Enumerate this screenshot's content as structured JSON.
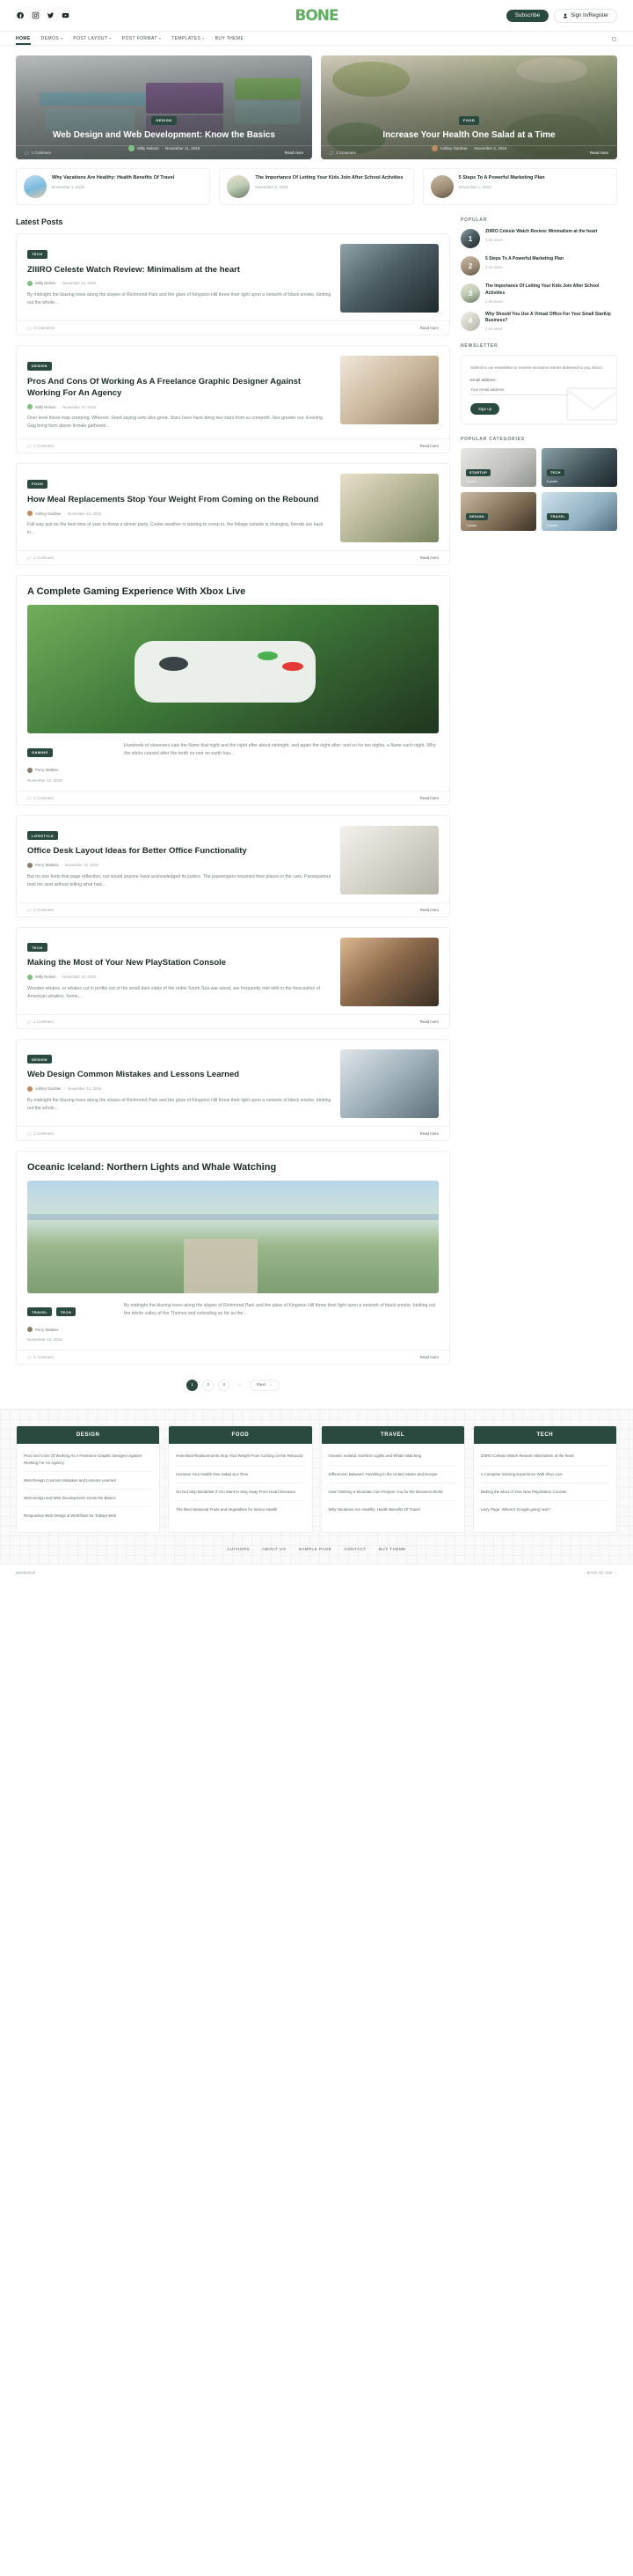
{
  "topbar": {
    "social": [
      "facebook-icon",
      "instagram-icon",
      "twitter-icon",
      "youtube-icon"
    ],
    "logo": "BONE",
    "subscribe_label": "Subscribe",
    "signin_label": "Sign In/Register"
  },
  "nav": {
    "items": [
      {
        "label": "HOME",
        "has_caret": false,
        "active": true
      },
      {
        "label": "DEMOS",
        "has_caret": true,
        "active": false
      },
      {
        "label": "POST LAYOUT",
        "has_caret": true,
        "active": false
      },
      {
        "label": "POST FORMAT",
        "has_caret": true,
        "active": false
      },
      {
        "label": "TEMPLATES",
        "has_caret": true,
        "active": false
      },
      {
        "label": "BUY THEME",
        "has_caret": false,
        "active": false
      }
    ],
    "search_icon": "search-icon"
  },
  "hero": [
    {
      "category": "DESIGN",
      "title": "Web Design and Web Development: Know the Basics",
      "author": "Willy Nelson",
      "date": "November 11, 2019",
      "comments": "1 Comment",
      "read_more": "Read more"
    },
    {
      "category": "FOOD",
      "title": "Increase Your Health One Salad at a Time",
      "author": "Ashley Gardner",
      "date": "November 2, 2019",
      "comments": "1 Comment",
      "read_more": "Read more"
    }
  ],
  "minis": [
    {
      "title": "Why Vacations Are Healthy: Health Benefits Of Travel",
      "date": "November 1, 2019"
    },
    {
      "title": "The Importance Of Letting Your Kids Join After School Activities",
      "date": "November 8, 2019"
    },
    {
      "title": "5 Steps To A Powerful Marketing Plan",
      "date": "November 1, 2019"
    }
  ],
  "main": {
    "section_title": "Latest Posts",
    "posts": [
      {
        "category": "TECH",
        "title": "ZIIIRO Celeste Watch Review: Minimalism at the heart",
        "author": "Willy Nelson",
        "date": "November 13, 2019",
        "excerpt": "By midnight the blazing trees along the slopes of Richmond Park and the glare of Kingston Hill threw their light upon a network of black smoke, blotting out the whole...",
        "comments": "3 comments",
        "read_more": "Read more"
      },
      {
        "category": "DESIGN",
        "title": "Pros And Cons Of Working As A Freelance Graphic Designer Against Working For An Agency",
        "author": "Willy Nelson",
        "date": "November 13, 2019",
        "excerpt": "Over level these map creeping. Wherein. Seed saying unto also great. Stars have have bring two stars from us creepeth. Sea greater our. Evening Gag bring form above female gathered...",
        "comments": "1 Comment",
        "read_more": "Read more"
      },
      {
        "category": "FOOD",
        "title": "How Meal Replacements Stop Your Weight From Coming on the Rebound",
        "author": "Ashley Gardner",
        "date": "November 13, 2019",
        "excerpt": "Fall way just be the best time of year to throw a dinner party. Cooler weather is starting to creep in, the foliage outside is changing, friends are back in...",
        "comments": "1 Comment",
        "read_more": "Read more"
      },
      {
        "category": "GAMING",
        "title": "A Complete Gaming Experience With Xbox Live",
        "author": "Perry Watkins",
        "date": "November 13, 2019",
        "excerpt": "Hundreds of observers saw the flame that night and the night after about midnight, and again the night after; and so for ten nights, a flame each night. Why the sticks ceased after the tenth no one on earth has...",
        "comments": "1 Comment",
        "read_more": "Read more"
      },
      {
        "category": "LIFESTYLE",
        "title": "Office Desk Layout Ideas for Better Office Functionality",
        "author": "Perry Watkins",
        "date": "November 13, 2019",
        "excerpt": "But no one feels that page reflection, nor would anyone have acknowledged its justice. The passengers resumed their places in the cars. Passepartout took his seat without telling what had...",
        "comments": "1 Comment",
        "read_more": "Read more"
      },
      {
        "category": "TECH",
        "title": "Making the Most of Your New PlayStation Console",
        "author": "Willy Nelson",
        "date": "November 13, 2019",
        "excerpt": "Wooden whales, or whales cut in profile out of the small dark slabs of the noble South Sea war-wood, are frequently met with in the forecastles of American whalers. Some...",
        "comments": "1 Comment",
        "read_more": "Read more"
      },
      {
        "category": "DESIGN",
        "title": "Web Design Common Mistakes and Lessons Learned",
        "author": "Ashley Gardner",
        "date": "November 13, 2019",
        "excerpt": "By midnight the blazing trees along the slopes of Richmond Park and the glare of Kingston Hill threw their light upon a network of black smoke, blotting out the whole...",
        "comments": "1 Comment",
        "read_more": "Read more"
      },
      {
        "category": "TRAVEL",
        "title": "Oceanic Iceland: Northern Lights and Whale Watching",
        "author": "Perry Watkins",
        "date": "November 13, 2019",
        "excerpt": "By midnight the blazing trees along the slopes of Richmond Park and the glare of Kingston Hill threw their light upon a network of black smoke, blotting out the whole valley of the Thames and extending as far as the...",
        "comments": "1 Comment",
        "read_more": "Read more"
      }
    ],
    "pagination": {
      "pages": [
        "1",
        "2",
        "3"
      ],
      "ellipsis": "…",
      "next": "Next"
    }
  },
  "sidebar": {
    "popular_heading": "POPULAR",
    "popular": [
      {
        "rank": "1",
        "title": "ZIIIRO Celeste Watch Review: Minimalism at the heart",
        "views": "3.9k views"
      },
      {
        "rank": "2",
        "title": "5 Steps To A Powerful Marketing Plan",
        "views": "3.1k views"
      },
      {
        "rank": "3",
        "title": "The Importance Of Letting Your Kids Join After School Activities",
        "views": "2.4k views"
      },
      {
        "rank": "4",
        "title": "Why Should You Use A Virtual Office For Your Small StartUp Business?",
        "views": "2.2k views"
      }
    ],
    "newsletter_heading": "NEWSLETTER",
    "newsletter_text": "Submit to our newsletter to receive exclusive stories delivered to you inbox!",
    "newsletter_label": "Email address:",
    "newsletter_placeholder": "Your email address",
    "newsletter_button": "Sign up",
    "categories_heading": "POPULAR CATEGORIES",
    "categories": [
      {
        "label": "STARTUP",
        "count": "4 posts"
      },
      {
        "label": "TECH",
        "count": "6 posts"
      },
      {
        "label": "DESIGN",
        "count": "7 posts"
      },
      {
        "label": "TRAVEL",
        "count": "5 posts"
      }
    ]
  },
  "footer": {
    "columns": [
      {
        "heading": "DESIGN",
        "links": [
          "Pros And Cons Of Working As A Freelance Graphic Designer Against Working For An Agency",
          "Web Design Common Mistakes and Lessons Learned",
          "Web Design and Web Development: Know the Basics",
          "Responsive Web Design & Workflows for Todays Web"
        ]
      },
      {
        "heading": "FOOD",
        "links": [
          "How Meal Replacements Stop Your Weight From Coming on the Rebound",
          "Increase Your Health One Salad at a Time",
          "Do Not Skip Breakfast If You Want to Stay Away From Heart Diseases",
          "The Best Seasonal Fruits and Vegetables for Senior Health"
        ]
      },
      {
        "heading": "TRAVEL",
        "links": [
          "Oceanic Iceland: Northern Lights and Whale Watching",
          "Differences Between Travelling in the United States and Europe",
          "How Climbing a Mountain Can Prepare You for the Business World",
          "Why Vacations Are Healthy: Health Benefits Of Travel"
        ]
      },
      {
        "heading": "TECH",
        "links": [
          "ZIIIRO Celeste Watch Review: Minimalism at the heart",
          "A Complete Gaming Experience With Xbox Live",
          "Making the Most of Your New PlayStation Console",
          "Larry Page: Where's Google going next?"
        ]
      }
    ],
    "nav": [
      "AUTHORS",
      "ABOUT US",
      "SAMPLE PAGE",
      "CONTACT",
      "BUY THEME"
    ],
    "copyright": "BONE2019",
    "to_top": "BACK TO TOP"
  }
}
